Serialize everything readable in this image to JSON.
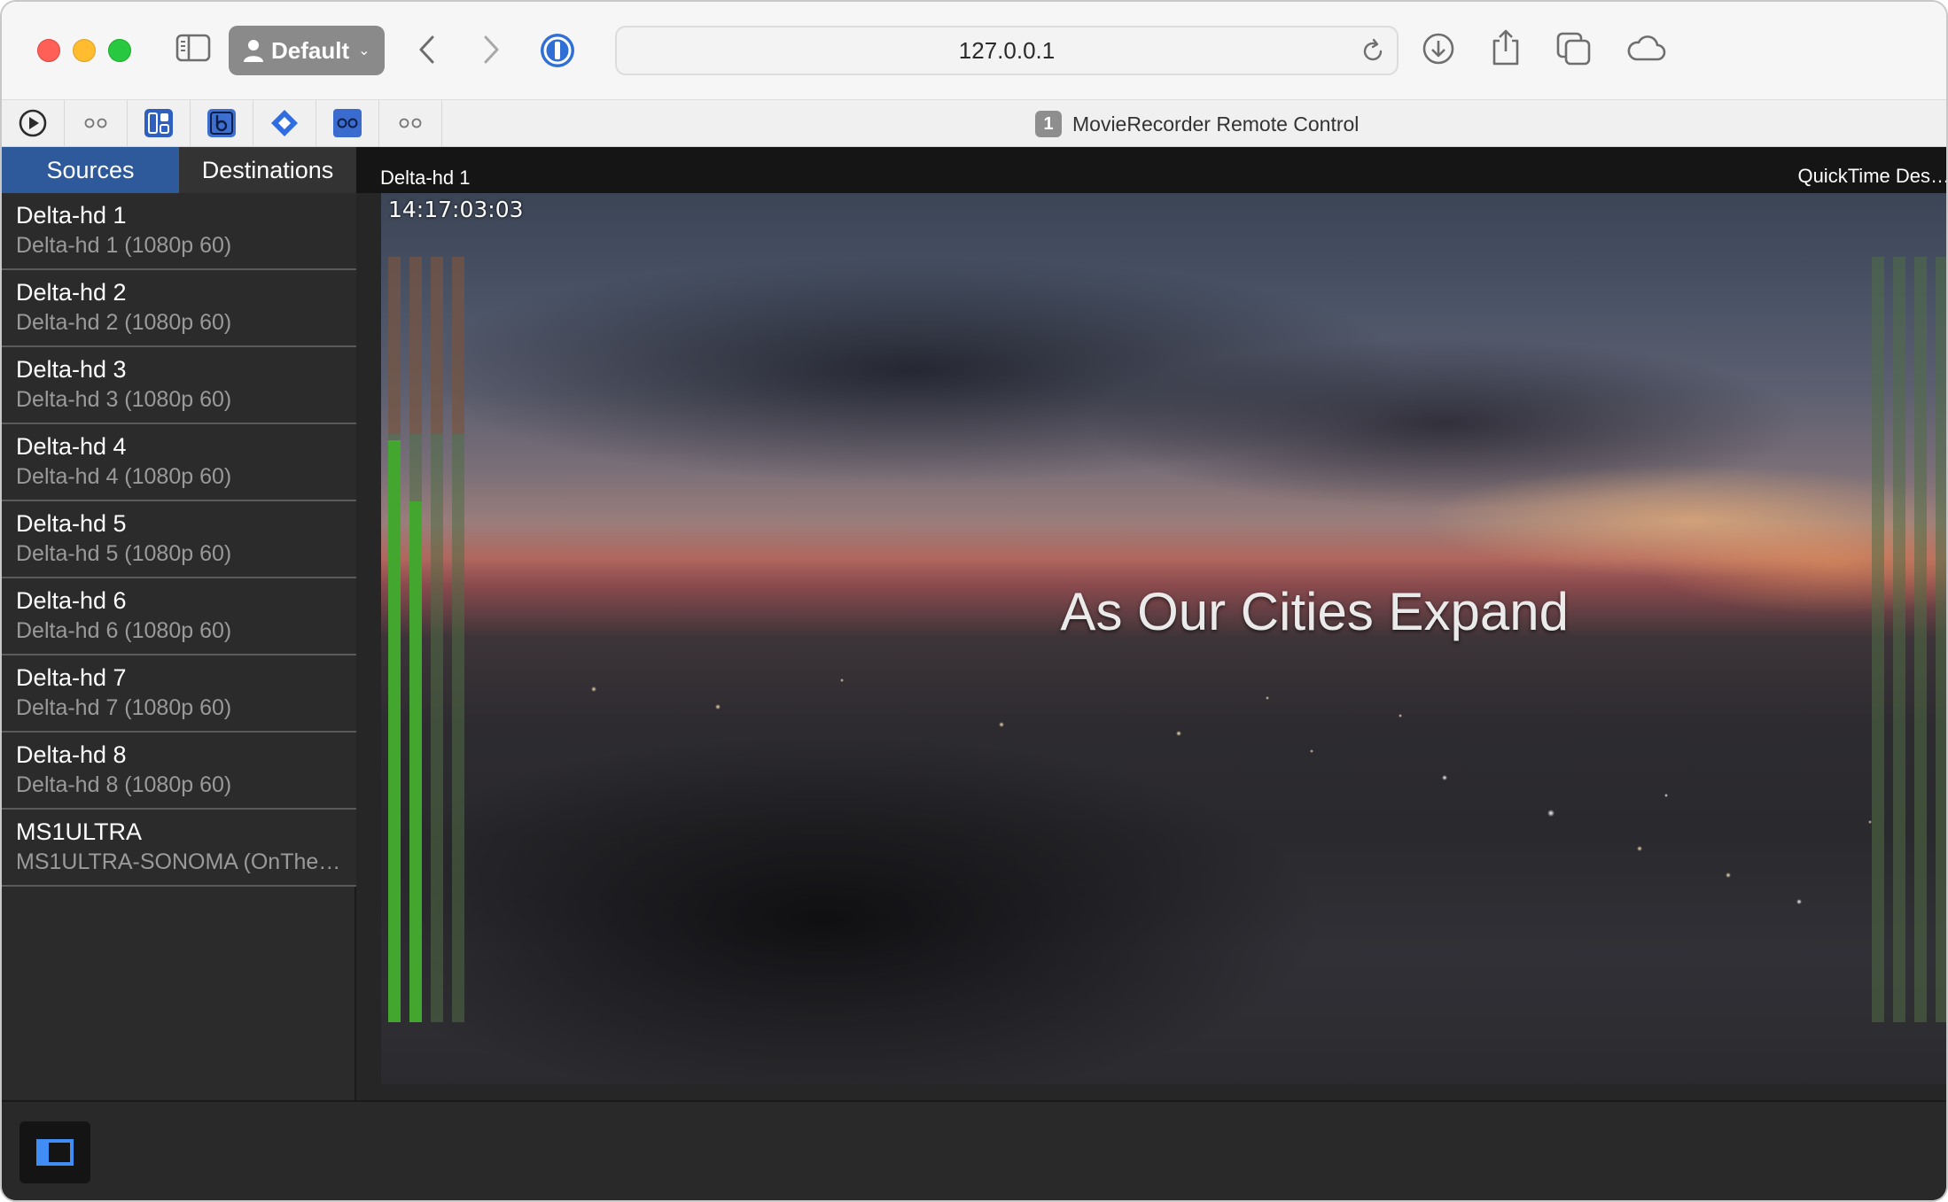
{
  "browser": {
    "profile": "Default",
    "address": "127.0.0.1",
    "tab": {
      "badge": "1",
      "title": "MovieRecorder Remote Control"
    },
    "pinned_tabs": [
      {
        "icon": "play-circle-icon"
      },
      {
        "icon": "dots-icon"
      },
      {
        "icon": "grid-app-icon"
      },
      {
        "icon": "b-app-icon"
      },
      {
        "icon": "diamond-app-icon"
      },
      {
        "icon": "blue-dots-icon"
      },
      {
        "icon": "dots-icon"
      }
    ]
  },
  "sidebar": {
    "tabs": {
      "sources": "Sources",
      "destinations": "Destinations"
    },
    "selected_tab": "sources",
    "items": [
      {
        "title": "Delta-hd 1",
        "subtitle": "Delta-hd 1 (1080p 60)"
      },
      {
        "title": "Delta-hd 2",
        "subtitle": "Delta-hd 2 (1080p 60)"
      },
      {
        "title": "Delta-hd 3",
        "subtitle": "Delta-hd 3 (1080p 60)"
      },
      {
        "title": "Delta-hd 4",
        "subtitle": "Delta-hd 4 (1080p 60)"
      },
      {
        "title": "Delta-hd 5",
        "subtitle": "Delta-hd 5 (1080p 60)"
      },
      {
        "title": "Delta-hd 6",
        "subtitle": "Delta-hd 6 (1080p 60)"
      },
      {
        "title": "Delta-hd 7",
        "subtitle": "Delta-hd 7 (1080p 60)"
      },
      {
        "title": "Delta-hd 8",
        "subtitle": "Delta-hd 8 (1080p 60)"
      },
      {
        "title": "MS1ULTRA",
        "subtitle": "MS1ULTRA-SONOMA (OnThe…"
      }
    ]
  },
  "preview": {
    "source_name": "Delta-hd 1",
    "destination_name": "QuickTime Des…",
    "timecode": "14:17:03:03",
    "overlay_text": "As Our Cities Expand",
    "left_meters": [
      0.76,
      0.68,
      0.0,
      0.0
    ],
    "right_meters": [
      0.0,
      0.0,
      0.0,
      0.0
    ]
  },
  "colors": {
    "accent": "#2e5a9c",
    "meter_green": "#43a62e",
    "panel_bg": "#2b2b2b"
  }
}
